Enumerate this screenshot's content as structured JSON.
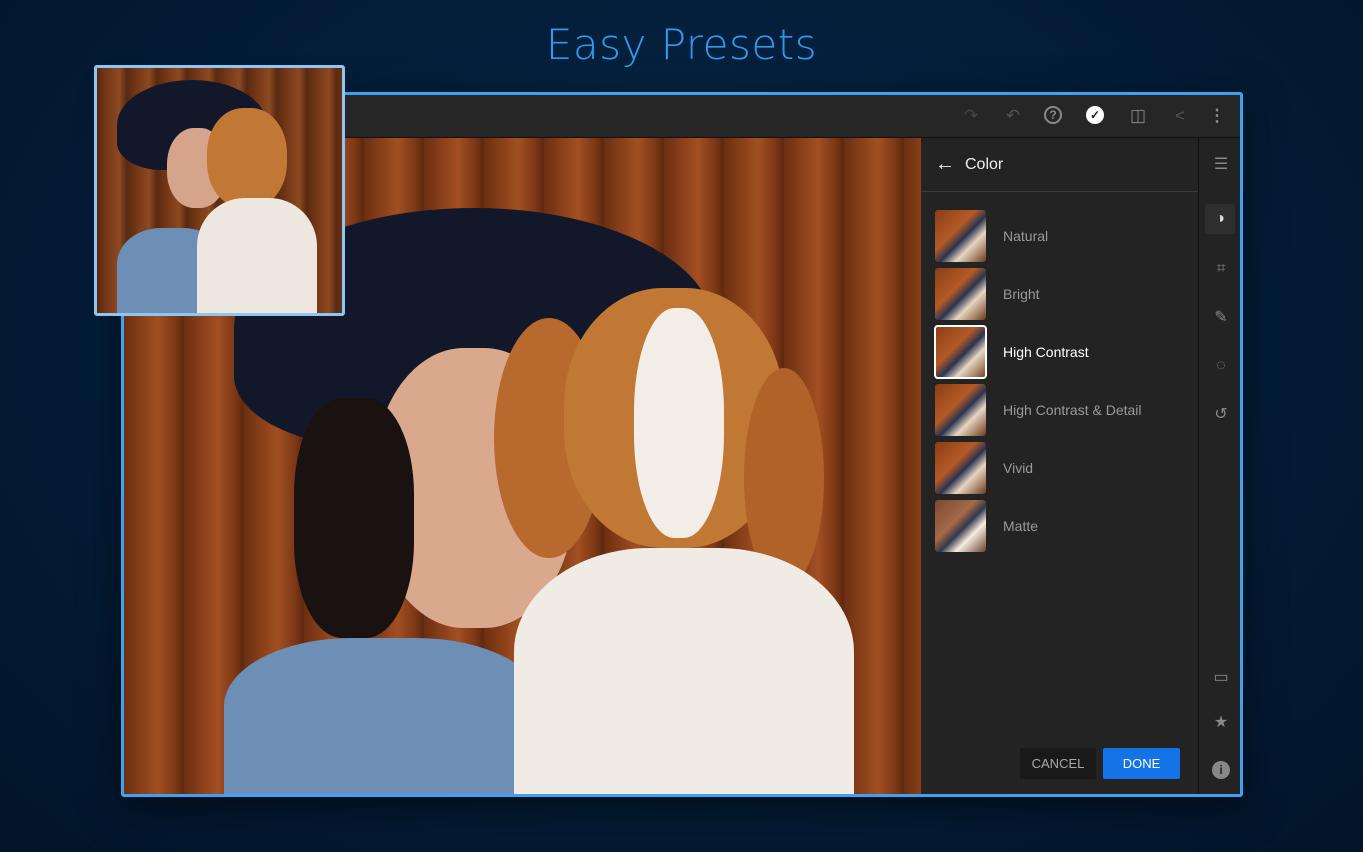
{
  "headline": "Easy Presets",
  "toolbar": {
    "icons": [
      "redo-icon",
      "undo-icon",
      "help-icon",
      "check-circle-icon",
      "compare-icon",
      "share-icon",
      "more-icon"
    ]
  },
  "panel": {
    "title": "Color",
    "back_icon": "arrow-left-icon",
    "presets": [
      {
        "label": "Natural"
      },
      {
        "label": "Bright"
      },
      {
        "label": "High Contrast"
      },
      {
        "label": "High Contrast & Detail"
      },
      {
        "label": "Vivid"
      },
      {
        "label": "Matte"
      }
    ],
    "selected": "High Contrast",
    "cancel_label": "CANCEL",
    "done_label": "DONE"
  },
  "rail": {
    "icons": [
      "sliders-icon",
      "presets-icon",
      "crop-icon",
      "healing-icon",
      "masking-icon",
      "history-icon",
      "comment-icon",
      "star-icon",
      "info-icon"
    ]
  },
  "colors": {
    "accent": "#1473e6",
    "frame": "#3ba3f1",
    "title": "#2f9bec"
  }
}
